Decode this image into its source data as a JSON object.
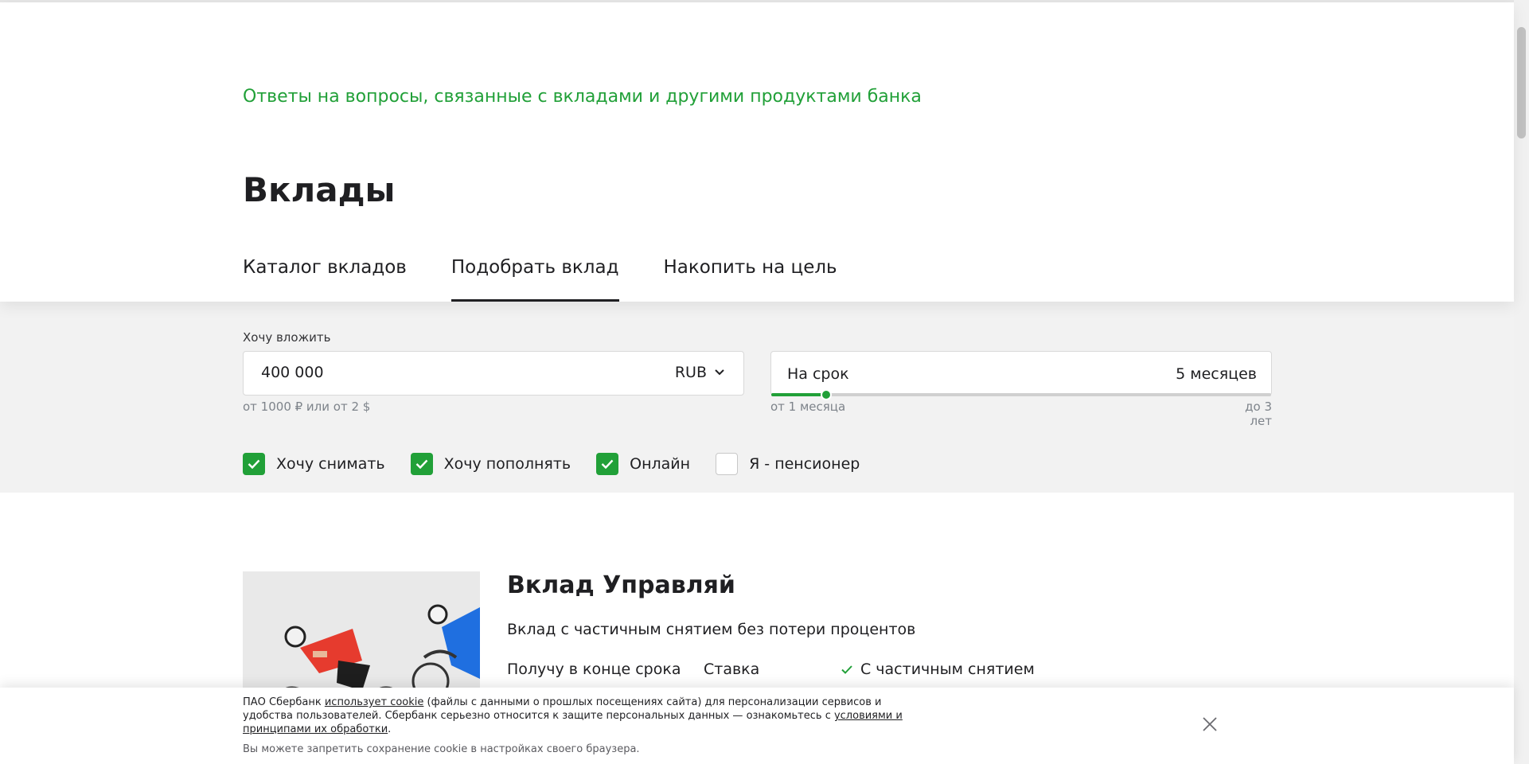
{
  "header": {
    "faq_link": "Ответы на вопросы, связанные с вкладами и другими продуктами банка",
    "title": "Вклады",
    "tabs": [
      {
        "label": "Каталог вкладов",
        "active": false
      },
      {
        "label": "Подобрать вклад",
        "active": true
      },
      {
        "label": "Накопить на цель",
        "active": false
      }
    ]
  },
  "filters": {
    "invest_label": "Хочу вложить",
    "amount_value": "400 000",
    "currency": "RUB",
    "amount_hint": "от 1000 ₽ или от 2 $",
    "term_label": "На срок",
    "term_value": "5 месяцев",
    "term_min": "от 1 месяца",
    "term_max": "до 3 лет",
    "term_slider_fraction": 0.11,
    "checkboxes": [
      {
        "label": "Хочу снимать",
        "checked": true
      },
      {
        "label": "Хочу пополнять",
        "checked": true
      },
      {
        "label": "Онлайн",
        "checked": true
      },
      {
        "label": "Я - пенсионер",
        "checked": false
      }
    ]
  },
  "card": {
    "title": "Вклад Управляй",
    "description": "Вклад с частичным снятием без потери процентов",
    "col1": "Получу в конце срока",
    "col2": "Ставка",
    "feature": "С частичным снятием"
  },
  "cookie": {
    "text_1": "ПАО Сбербанк ",
    "link_1": "использует cookie",
    "text_2": " (файлы с данными о прошлых посещениях сайта) для персонализации сервисов и удобства пользователей. Сбербанк серьезно относится к защите персональных данных — ознакомьтесь с ",
    "link_2": "условиями и принципами их обработки",
    "text_3": ".",
    "note": "Вы можете запретить сохранение cookie в настройках своего браузера."
  },
  "colors": {
    "accent": "#21a038",
    "text": "#1f1f22",
    "filters_bg": "#f2f2f2"
  }
}
